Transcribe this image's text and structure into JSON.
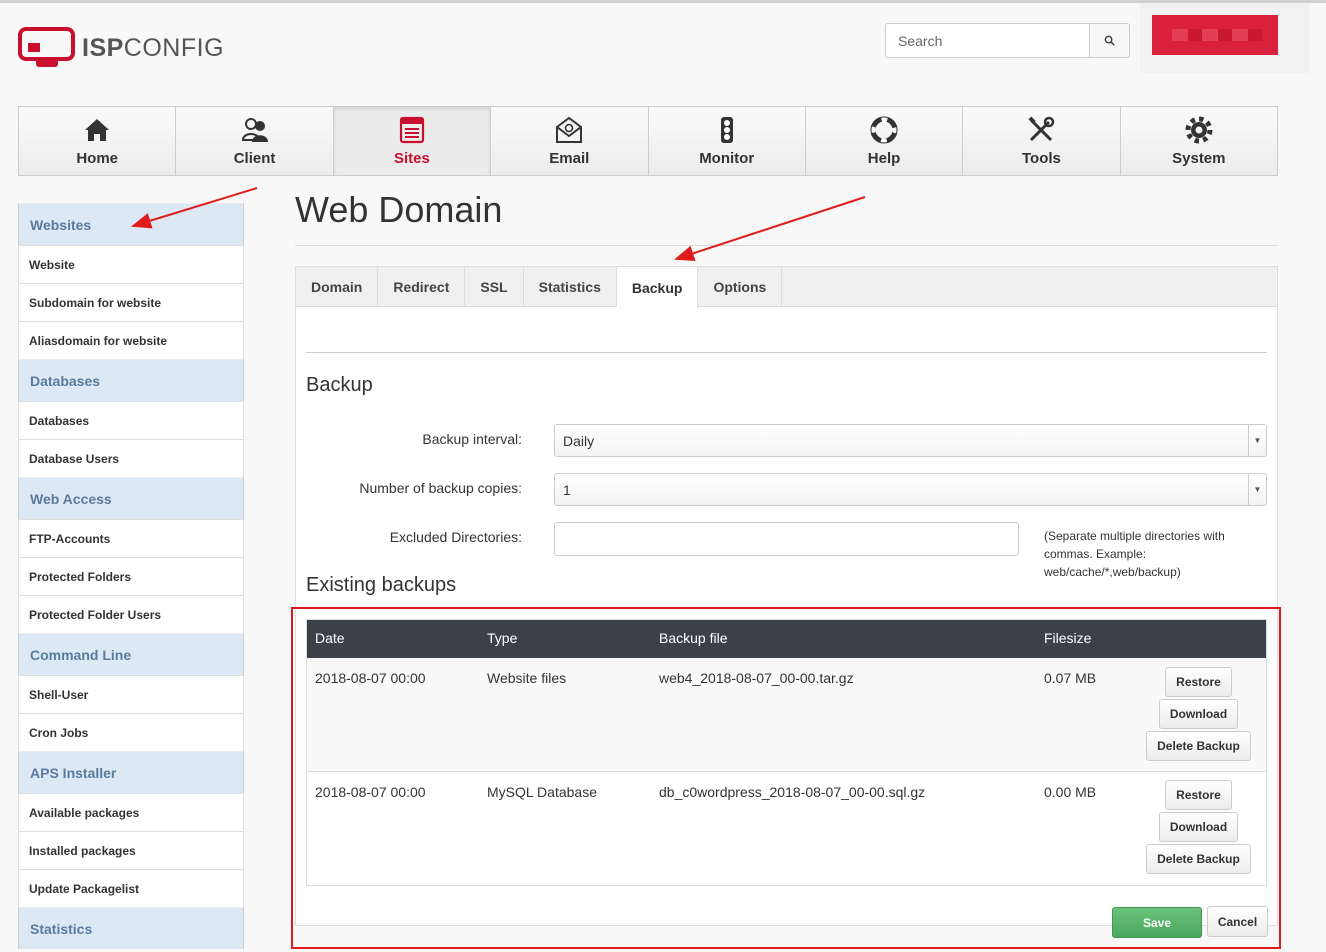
{
  "header": {
    "logo_bold": "ISP",
    "logo_light": "CONFIG",
    "search_placeholder": "Search"
  },
  "topnav": [
    {
      "label": "Home",
      "icon": "home-icon"
    },
    {
      "label": "Client",
      "icon": "users-icon"
    },
    {
      "label": "Sites",
      "icon": "sites-icon",
      "active": true
    },
    {
      "label": "Email",
      "icon": "envelope-icon"
    },
    {
      "label": "Monitor",
      "icon": "traffic-light-icon"
    },
    {
      "label": "Help",
      "icon": "lifebuoy-icon"
    },
    {
      "label": "Tools",
      "icon": "tools-icon"
    },
    {
      "label": "System",
      "icon": "gear-icon"
    }
  ],
  "sidebar": {
    "sections": [
      {
        "title": "Websites",
        "items": [
          "Website",
          "Subdomain for website",
          "Aliasdomain for website"
        ]
      },
      {
        "title": "Databases",
        "items": [
          "Databases",
          "Database Users"
        ]
      },
      {
        "title": "Web Access",
        "items": [
          "FTP-Accounts",
          "Protected Folders",
          "Protected Folder Users"
        ]
      },
      {
        "title": "Command Line",
        "items": [
          "Shell-User",
          "Cron Jobs"
        ]
      },
      {
        "title": "APS Installer",
        "items": [
          "Available packages",
          "Installed packages",
          "Update Packagelist"
        ]
      },
      {
        "title": "Statistics",
        "items": []
      }
    ]
  },
  "main": {
    "title": "Web Domain",
    "tabs": [
      "Domain",
      "Redirect",
      "SSL",
      "Statistics",
      "Backup",
      "Options"
    ],
    "active_tab": "Backup",
    "backup": {
      "section_title": "Backup",
      "interval_label": "Backup interval:",
      "interval_value": "Daily",
      "copies_label": "Number of backup copies:",
      "copies_value": "1",
      "excluded_label": "Excluded Directories:",
      "excluded_value": "",
      "excluded_hint": "(Separate multiple directories with commas. Example: web/cache/*,web/backup)"
    },
    "existing": {
      "section_title": "Existing backups",
      "columns": [
        "Date",
        "Type",
        "Backup file",
        "Filesize"
      ],
      "rows": [
        {
          "date": "2018-08-07 00:00",
          "type": "Website files",
          "file": "web4_2018-08-07_00-00.tar.gz",
          "size": "0.07 MB"
        },
        {
          "date": "2018-08-07 00:00",
          "type": "MySQL Database",
          "file": "db_c0wordpress_2018-08-07_00-00.sql.gz",
          "size": "0.00 MB"
        }
      ],
      "restore_label": "Restore",
      "download_label": "Download",
      "delete_label": "Delete Backup"
    },
    "save_label": "Save",
    "cancel_label": "Cancel"
  },
  "colors": {
    "accent": "#c8102e",
    "annotation": "#e01b1b",
    "table_header": "#3b4146",
    "sidebar_head": "#dce8f4",
    "save_button": "#4aa85c"
  }
}
